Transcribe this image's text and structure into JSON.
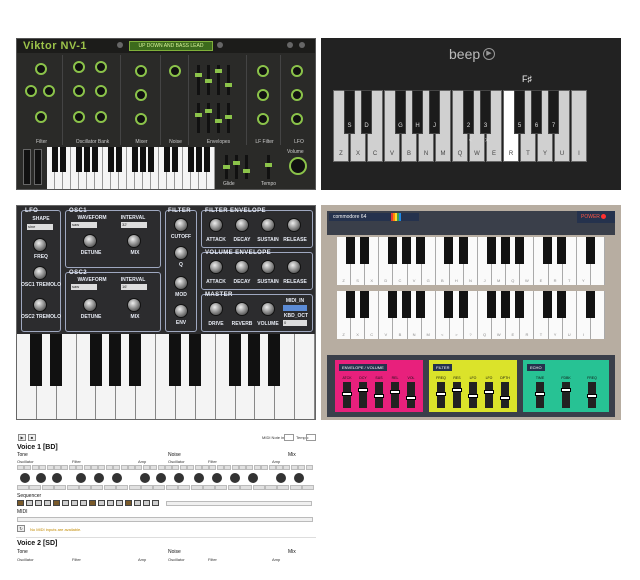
{
  "viktor": {
    "logo": "Viktor NV-1",
    "preset": "UP DOWN AND BASS LEAD",
    "sections": [
      "Filter",
      "Oscillator Bank",
      "Mixer",
      "Noise",
      "Envelopes",
      "LF Filter",
      "LFO"
    ],
    "bottom_labels": [
      "Glide",
      "Tempo",
      "Volume"
    ],
    "accent": "#8bc34a"
  },
  "beep": {
    "title": "beep",
    "play_icon": "play-circle-icon",
    "current_note": "F♯",
    "white_labels": [
      "Z",
      "X",
      "C",
      "V",
      "B",
      "N",
      "M",
      "Q",
      "W",
      "E",
      "R",
      "T",
      "Y",
      "U",
      "I"
    ],
    "black_labels": [
      "S",
      "D",
      "G",
      "H",
      "J",
      "2",
      "3",
      "5",
      "6",
      "7"
    ],
    "mid_labels": [
      "<",
      ">"
    ]
  },
  "knobsynth": {
    "lfo": {
      "title": "LFO",
      "shape": "SHAPE",
      "shape_value": "sine",
      "freq": "FREQ",
      "osc1_tremolo": "OSC1 TREMOLO",
      "osc2_tremolo": "OSC2 TREMOLO"
    },
    "osc1": {
      "title": "OSC1",
      "waveform": "WAVEFORM",
      "waveform_value": "saw",
      "interval": "INTERVAL",
      "interval_value": "32'",
      "detune": "DETUNE",
      "mix": "MIX"
    },
    "osc2": {
      "title": "OSC2",
      "waveform": "WAVEFORM",
      "waveform_value": "saw",
      "interval": "INTERVAL",
      "interval_value": "16'",
      "detune": "DETUNE",
      "mix": "MIX"
    },
    "filter": {
      "title": "FILTER",
      "cutoff": "CUTOFF",
      "q": "Q",
      "mod": "MOD",
      "env": "ENV"
    },
    "filter_env": {
      "title": "FILTER ENVELOPE",
      "attack": "ATTACK",
      "decay": "DECAY",
      "sustain": "SUSTAIN",
      "release": "RELEASE"
    },
    "volume_env": {
      "title": "VOLUME ENVELOPE",
      "attack": "ATTACK",
      "decay": "DECAY",
      "sustain": "SUSTAIN",
      "release": "RELEASE"
    },
    "master": {
      "title": "MASTER",
      "drive": "DRIVE",
      "reverb": "REVERB",
      "volume": "VOLUME",
      "midi_in": "MIDI_IN",
      "kbd_oct": "KBD_OCT",
      "kbd_oct_value": "0"
    }
  },
  "commodore": {
    "logo": "commodore 64",
    "power": "POWER",
    "top_row_white": [
      "Z",
      "S",
      "X",
      "D",
      "C",
      "V",
      "G",
      "B",
      "H",
      "N",
      "J",
      "M",
      "Q",
      "W",
      "E",
      "R",
      "T",
      "Y"
    ],
    "bottom_row_white": [
      "Z",
      "X",
      "C",
      "V",
      "B",
      "N",
      "M",
      "<",
      ">",
      "?",
      "Q",
      "W",
      "E",
      "R",
      "T",
      "Y",
      "U",
      "I"
    ],
    "modules": [
      {
        "title": "ENVELOPE / VOLUME",
        "color": "#e8207c",
        "faders": [
          "ATCK",
          "DCY",
          "SUS",
          "REL",
          "VOL"
        ]
      },
      {
        "title": "FILTER",
        "color": "#dbe32a",
        "faders": [
          "FREQ",
          "RES",
          "LFO",
          "LFO",
          "DPTH"
        ]
      },
      {
        "title": "ECHO",
        "color": "#27c294",
        "faders": [
          "TIME",
          "FDBK",
          "FREQ"
        ]
      }
    ]
  },
  "drum": {
    "midi_note": "MIDI Note in:",
    "tempo": "Tempo:",
    "voice1": "Voice 1 [BD]",
    "voice2": "Voice 2 [SD]",
    "tone": "Tone",
    "noise": "Noise",
    "mix": "Mix",
    "oscillator": "Oscillator",
    "filter": "Filter",
    "amp": "Amp",
    "sequencer": "Sequencer",
    "midi": "MIDI",
    "midi_warning": "No MIDI inputs are available."
  }
}
